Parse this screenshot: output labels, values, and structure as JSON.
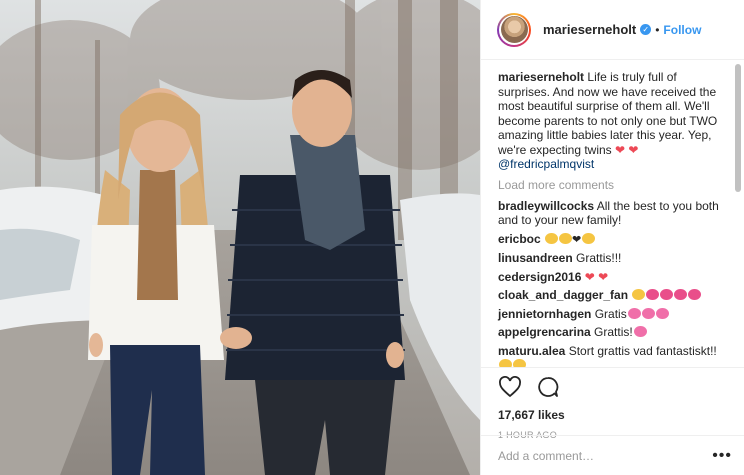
{
  "post": {
    "username": "marieserneholt",
    "follow_label": "Follow",
    "dot": "•",
    "caption": "Life is truly full of surprises. And now we have received the most beautiful surprise of them all. We'll become parents to not only one but TWO amazing little babies later this year. Yep, we're expecting twins",
    "caption_mention": "@fredricpalmqvist",
    "load_more_label": "Load more comments",
    "comments": [
      {
        "user": "bradleywillcocks",
        "text": "All the best to you both and to your new family!"
      },
      {
        "user": "ericboc",
        "text": ""
      },
      {
        "user": "linusandreen",
        "text": "Grattis!!!"
      },
      {
        "user": "cedersign2016",
        "text": ""
      },
      {
        "user": "cloak_and_dagger_fan",
        "text": ""
      },
      {
        "user": "jennietornhagen",
        "text": "Gratis"
      },
      {
        "user": "appelgrencarina",
        "text": "Grattis!"
      },
      {
        "user": "maturu.alea",
        "text": "Stort grattis vad fantastiskt!!"
      }
    ],
    "likes": "17,667 likes",
    "time": "1 HOUR AGO",
    "add_comment_placeholder": "Add a comment…",
    "more_label": "•••"
  },
  "icons": [
    "heart-icon",
    "comment-icon",
    "verified-icon",
    "more-options-icon"
  ],
  "colors": {
    "accent": "#3897f0",
    "heart": "#ed4956",
    "muted": "#999999",
    "text": "#262626",
    "border": "#efefef"
  }
}
